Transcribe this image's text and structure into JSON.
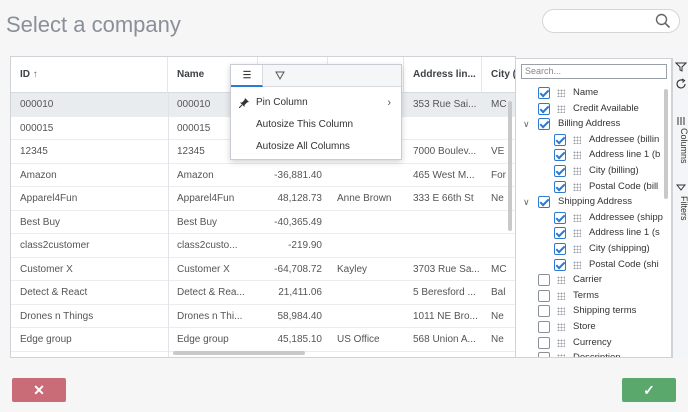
{
  "page": {
    "title": "Select a company"
  },
  "icons": {
    "search": "search-icon",
    "menu": "hamburger-icon",
    "filter": "filter-icon",
    "pin": "pin-icon",
    "sort": "sort-asc-icon"
  },
  "grid": {
    "columns": [
      "ID",
      "Name",
      "",
      "",
      "Address lin...",
      "City (b"
    ],
    "sort_indicator": "↑",
    "rows": [
      [
        "000010",
        "000010",
        "",
        "",
        "353 Rue Sai...",
        "MC"
      ],
      [
        "000015",
        "000015",
        "",
        "",
        "",
        ""
      ],
      [
        "12345",
        "12345",
        "",
        "",
        "7000 Boulev...",
        "VE"
      ],
      [
        "Amazon",
        "Amazon",
        "-36,881.40",
        "",
        "465 West M...",
        "For"
      ],
      [
        "Apparel4Fun",
        "Apparel4Fun",
        "48,128.73",
        "Anne Brown",
        "333 E 66th St",
        "Ne"
      ],
      [
        "Best Buy",
        "Best Buy",
        "-40,365.49",
        "",
        "",
        ""
      ],
      [
        "class2customer",
        "class2custo...",
        "-219.90",
        "",
        "",
        ""
      ],
      [
        "Customer X",
        "Customer X",
        "-64,708.72",
        "Kayley",
        "3703 Rue Sa...",
        "MC"
      ],
      [
        "Detect & React",
        "Detect & Rea...",
        "21,411.06",
        "",
        "5 Beresford ...",
        "Bal"
      ],
      [
        "Drones n Things",
        "Drones n Thi...",
        "58,984.40",
        "",
        "1011 NE Bro...",
        "Ne"
      ],
      [
        "Edge group",
        "Edge group",
        "45,185.10",
        "US Office",
        "568 Union A...",
        "Ne"
      ]
    ]
  },
  "column_menu": {
    "items": [
      {
        "label": "Pin Column",
        "chevron": "›"
      },
      {
        "label": "Autosize This Column"
      },
      {
        "label": "Autosize All Columns"
      }
    ]
  },
  "tool_panel": {
    "search_placeholder": "Search...",
    "items": [
      {
        "label": "Name",
        "checked": true,
        "level": 0
      },
      {
        "label": "Credit Available",
        "checked": true,
        "level": 0
      },
      {
        "label": "Billing Address",
        "checked": true,
        "level": 0,
        "group": true
      },
      {
        "label": "Addressee (billin",
        "checked": true,
        "level": 1
      },
      {
        "label": "Address line 1 (b",
        "checked": true,
        "level": 1
      },
      {
        "label": "City (billing)",
        "checked": true,
        "level": 1
      },
      {
        "label": "Postal Code (bill",
        "checked": true,
        "level": 1
      },
      {
        "label": "Shipping Address",
        "checked": true,
        "level": 0,
        "group": true
      },
      {
        "label": "Addressee (shipp",
        "checked": true,
        "level": 1
      },
      {
        "label": "Address line 1 (s",
        "checked": true,
        "level": 1
      },
      {
        "label": "City (shipping)",
        "checked": true,
        "level": 1
      },
      {
        "label": "Postal Code (shi",
        "checked": true,
        "level": 1
      },
      {
        "label": "Carrier",
        "checked": false,
        "level": 0
      },
      {
        "label": "Terms",
        "checked": false,
        "level": 0
      },
      {
        "label": "Shipping terms",
        "checked": false,
        "level": 0
      },
      {
        "label": "Store",
        "checked": false,
        "level": 0
      },
      {
        "label": "Currency",
        "checked": false,
        "level": 0
      },
      {
        "label": "Description",
        "checked": false,
        "level": 0
      }
    ]
  },
  "side_tabs": {
    "columns": "Columns",
    "filters": "Filters"
  },
  "buttons": {
    "cancel": "✕",
    "ok": "✓"
  }
}
